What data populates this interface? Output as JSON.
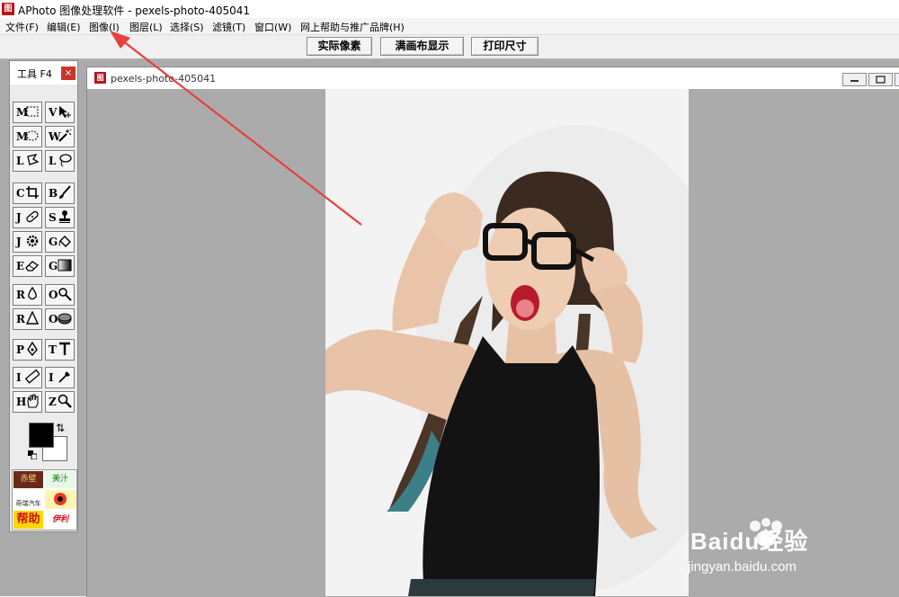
{
  "window": {
    "title": "APhoto 图像处理软件 - pexels-photo-405041",
    "logo_text": "图"
  },
  "menu": [
    {
      "label": "文件(F)"
    },
    {
      "label": "编辑(E)"
    },
    {
      "label": "图像(I)"
    },
    {
      "label": "图层(L)"
    },
    {
      "label": "选择(S)"
    },
    {
      "label": "滤镜(T)"
    },
    {
      "label": "窗口(W)"
    },
    {
      "label": "网上帮助与推广品牌(H)"
    }
  ],
  "toolbar": {
    "actual_pixels": "实际像素",
    "fit_canvas": "满画布显示",
    "print_size": "打印尺寸"
  },
  "tool_panel": {
    "title": "工具 F4",
    "close": "×",
    "tools": [
      {
        "key": "M",
        "icon": "rect-marquee-icon"
      },
      {
        "key": "V",
        "icon": "move-icon"
      },
      {
        "key": "M",
        "icon": "ellipse-marquee-icon"
      },
      {
        "key": "W",
        "icon": "magic-wand-icon"
      },
      {
        "key": "L",
        "icon": "lasso-icon"
      },
      {
        "key": "L",
        "icon": "poly-lasso-icon"
      },
      {
        "key": "C",
        "icon": "crop-icon"
      },
      {
        "key": "B",
        "icon": "brush-icon"
      },
      {
        "key": "J",
        "icon": "bandage-icon"
      },
      {
        "key": "S",
        "icon": "stamp-icon"
      },
      {
        "key": "J",
        "icon": "gear-stamp-icon"
      },
      {
        "key": "G",
        "icon": "bucket-icon"
      },
      {
        "key": "E",
        "icon": "eraser-icon"
      },
      {
        "key": "G",
        "icon": "gradient-icon"
      },
      {
        "key": "R",
        "icon": "blur-drop-icon"
      },
      {
        "key": "O",
        "icon": "dodge-icon"
      },
      {
        "key": "R",
        "icon": "sharpen-icon"
      },
      {
        "key": "O",
        "icon": "sponge-icon"
      },
      {
        "key": "P",
        "icon": "pen-icon"
      },
      {
        "key": "T",
        "icon": "text-icon"
      },
      {
        "key": "I",
        "icon": "ruler-icon"
      },
      {
        "key": "I",
        "icon": "eyedropper-icon"
      },
      {
        "key": "H",
        "icon": "hand-icon"
      },
      {
        "key": "Z",
        "icon": "zoom-icon"
      }
    ],
    "foreground_color": "#000000",
    "background_color": "#ffffff",
    "ads": [
      "赤壁",
      "美汁",
      "奇瑞汽车",
      "帮助",
      "伊利"
    ]
  },
  "document": {
    "title": "pexels-photo-405041",
    "icon_text": "图"
  },
  "watermark": {
    "brand": "Baidu经验",
    "url": "jingyan.baidu.com"
  },
  "colors": {
    "annotation_arrow": "#e8403a",
    "workspace": "#ababab",
    "brand_red": "#b8141a"
  }
}
